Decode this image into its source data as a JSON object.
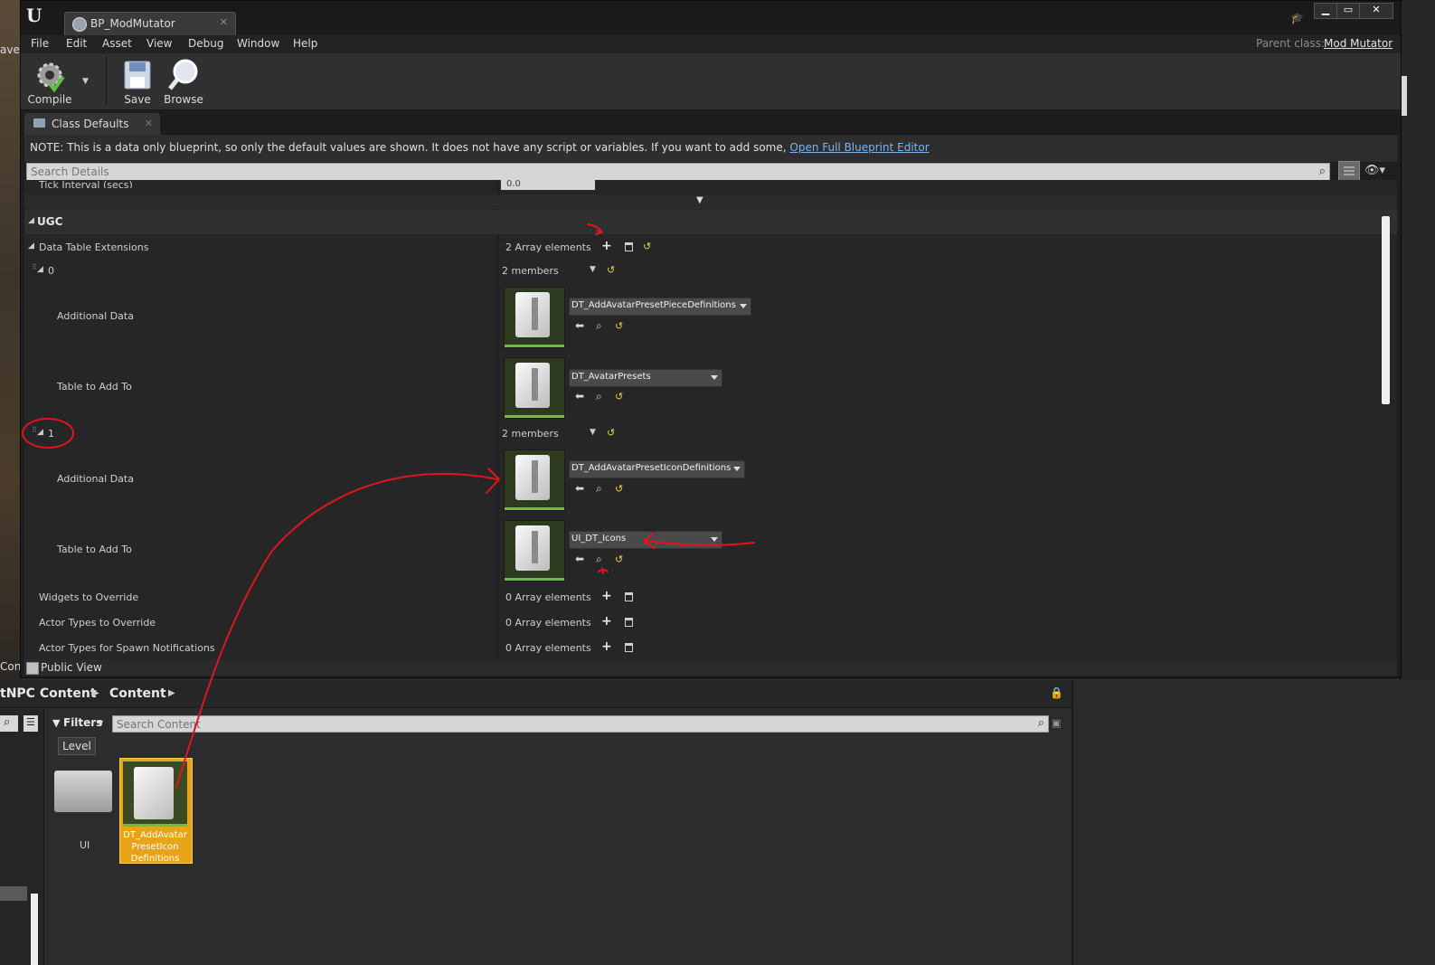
{
  "window": {
    "title": "BP_ModMutator",
    "parent_class_label": "Parent class:",
    "parent_class_value": "Mod Mutator"
  },
  "menu": [
    "File",
    "Edit",
    "Asset",
    "View",
    "Debug",
    "Window",
    "Help"
  ],
  "toolbar": {
    "compile": "Compile",
    "save": "Save",
    "browse": "Browse"
  },
  "panel_tab": "Class Defaults",
  "note": {
    "text": "NOTE: This is a data only blueprint, so only the default values are shown.  It does not have any script or variables.  If you want to add some,",
    "link": "Open Full Blueprint Editor"
  },
  "search": {
    "placeholder": "Search Details"
  },
  "tick": {
    "label": "Tick Interval (secs)",
    "value": "0.0"
  },
  "category": "UGC",
  "dte": {
    "label": "Data Table Extensions",
    "count": "2 Array elements",
    "elements": [
      {
        "index": "0",
        "members": "2 members",
        "additional_label": "Additional Data",
        "additional_value": "DT_AddAvatarPresetPieceDefinitions",
        "table_label": "Table to Add To",
        "table_value": "DT_AvatarPresets"
      },
      {
        "index": "1",
        "members": "2 members",
        "additional_label": "Additional Data",
        "additional_value": "DT_AddAvatarPresetIconDefinitions",
        "table_label": "Table to Add To",
        "table_value": "UI_DT_Icons"
      }
    ]
  },
  "other_props": [
    {
      "label": "Widgets to Override",
      "value": "0 Array elements"
    },
    {
      "label": "Actor Types to Override",
      "value": "0 Array elements"
    },
    {
      "label": "Actor Types for Spawn Notifications",
      "value": "0 Array elements"
    }
  ],
  "public_view": "Public View",
  "content_browser": {
    "crumbs": [
      "tNPC Content",
      "Content"
    ],
    "filters": "Filters",
    "search_placeholder": "Search Content",
    "level_chip": "Level",
    "folder_label": "UI",
    "asset_label_lines": [
      "DT_AddAvatar",
      "PresetIcon",
      "Definitions"
    ]
  },
  "colors": {
    "annotation": "#e0141e",
    "accent_link": "#7fb4ec",
    "selected_asset": "#e8a417"
  }
}
